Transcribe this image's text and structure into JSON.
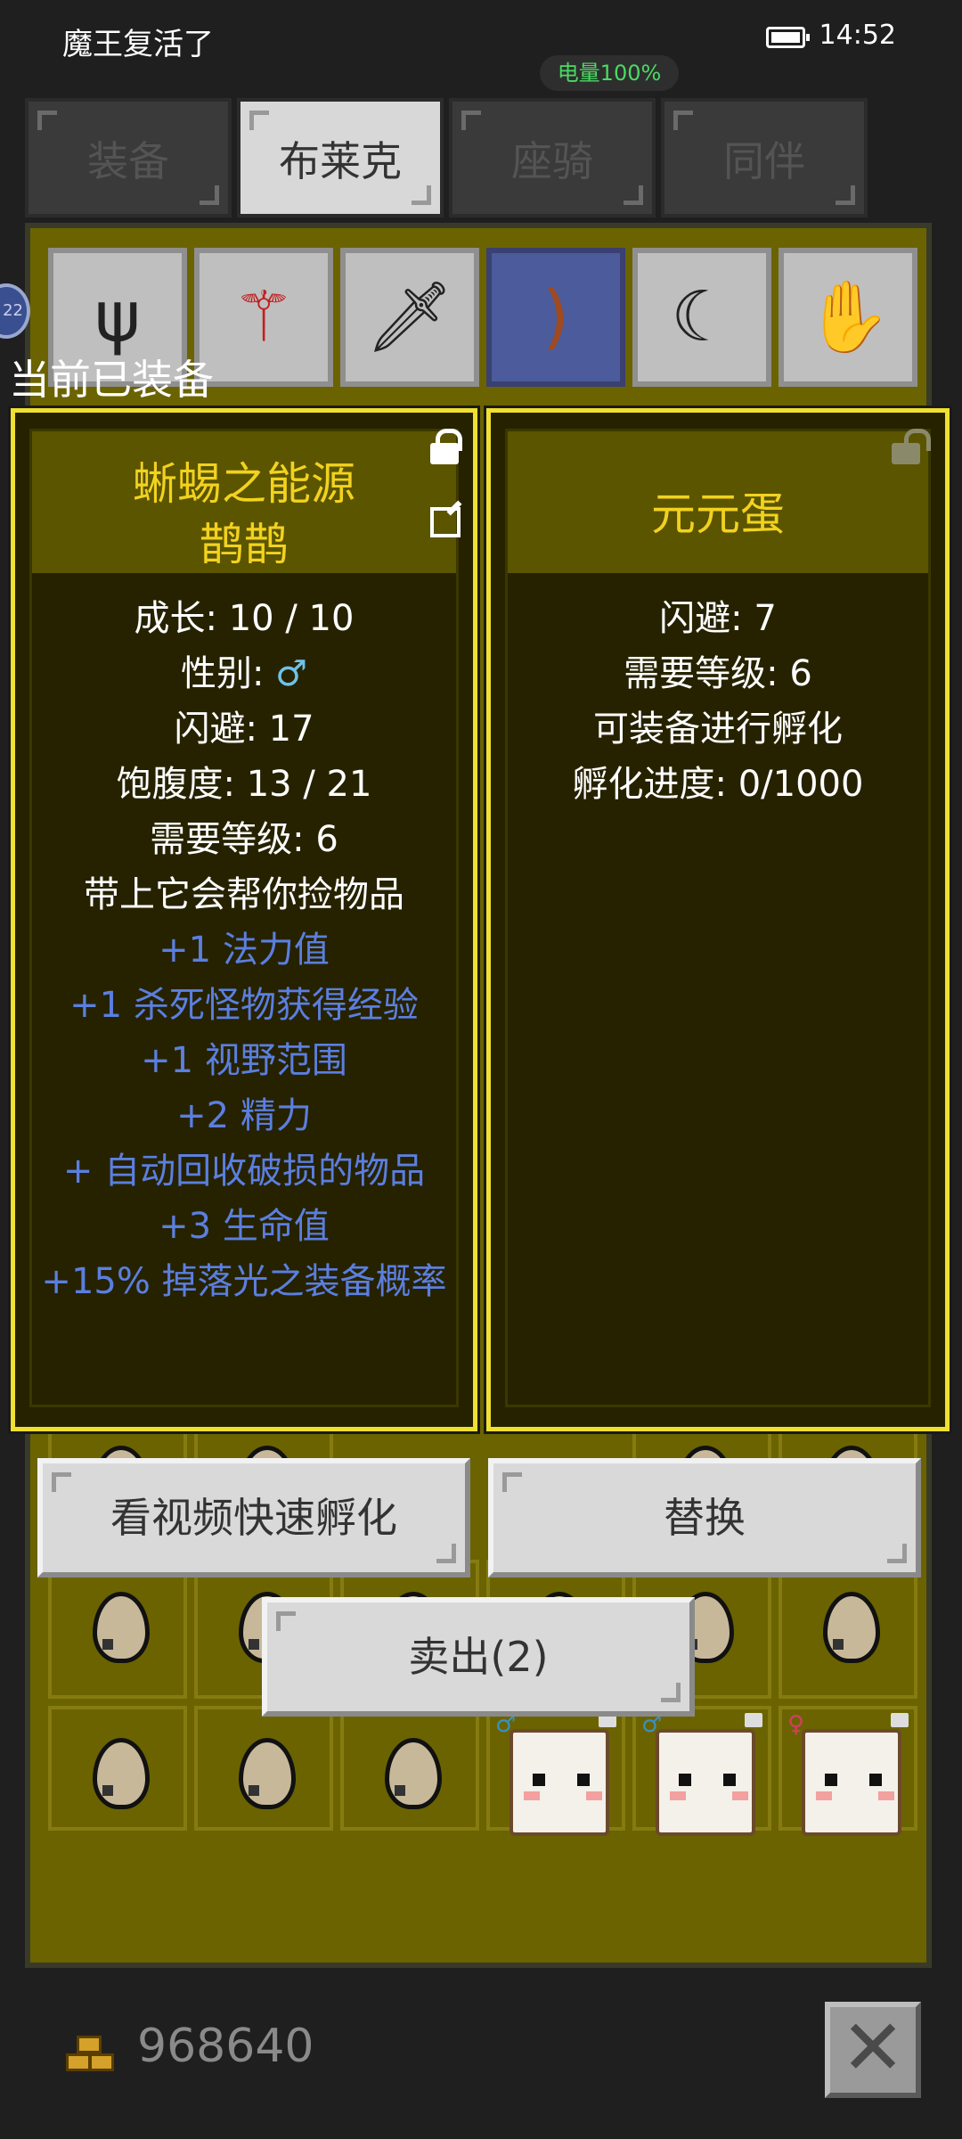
{
  "status": {
    "app_name": "魔王复活了",
    "time": "14:52",
    "battery_label": "电量100%",
    "battery_level": 1.0
  },
  "tabs": [
    {
      "label": "装备",
      "active": false
    },
    {
      "label": "布莱克",
      "active": true
    },
    {
      "label": "座骑",
      "active": false
    },
    {
      "label": "同伴",
      "active": false
    }
  ],
  "equipment_slots": [
    {
      "icon": "trident-icon"
    },
    {
      "icon": "ruby-scepter-icon"
    },
    {
      "icon": "dagger-icon"
    },
    {
      "icon": "bow-icon",
      "selected": true
    },
    {
      "icon": "scimitar-icon"
    },
    {
      "icon": "glove-icon"
    }
  ],
  "side_bubble": "22",
  "section_title": "当前已装备",
  "current_item": {
    "name": "蜥蜴之能源",
    "subname": "鹊鹊",
    "stats": [
      {
        "text": "成长: 10 / 10",
        "color": "white"
      },
      {
        "text": "性别: ",
        "gender": "♂",
        "color": "white"
      },
      {
        "text": "闪避: 17",
        "color": "white"
      },
      {
        "text": "饱腹度: 13 / 21",
        "color": "white"
      },
      {
        "text": "需要等级: 6",
        "color": "white"
      },
      {
        "text": "带上它会帮你捡物品",
        "color": "white"
      },
      {
        "text": "+1 法力值",
        "color": "blue"
      },
      {
        "text": "+1 杀死怪物获得经验",
        "color": "blue"
      },
      {
        "text": "+1 视野范围",
        "color": "blue"
      },
      {
        "text": "+2 精力",
        "color": "blue"
      },
      {
        "text": "+ 自动回收破损的物品",
        "color": "blue"
      },
      {
        "text": "+3 生命值",
        "color": "blue"
      },
      {
        "text": "+15% 掉落光之装备概率",
        "color": "blue"
      }
    ]
  },
  "compare_item": {
    "name": "元元蛋",
    "stats": [
      {
        "text": "闪避: 7"
      },
      {
        "text": "需要等级: 6"
      },
      {
        "text": "可装备进行孵化"
      },
      {
        "text": "孵化进度: 0/1000"
      }
    ]
  },
  "buttons": {
    "fast_hatch": "看视频快速孵化",
    "replace": "替换",
    "sell": "卖出(2)"
  },
  "gold": "968640",
  "close_label": "✕",
  "colors": {
    "panel_border": "#f0e030",
    "item_name": "#f2d21f",
    "bonus_text": "#5b7fe0",
    "gender_male": "#6ec3e8",
    "charge_text": "#4cd964"
  }
}
